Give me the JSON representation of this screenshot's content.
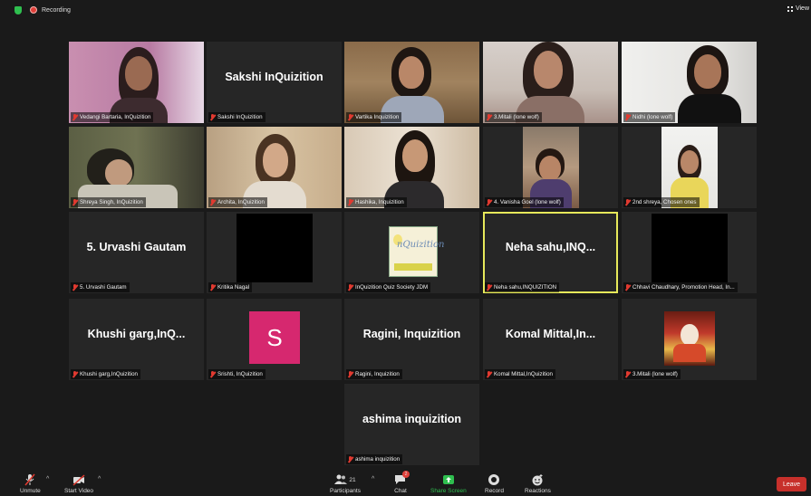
{
  "topbar": {
    "recording": "Recording",
    "view": "View"
  },
  "tiles": [
    {
      "label": "Vedangi Bartaria, InQuizition"
    },
    {
      "label": "Sakshi InQuizition",
      "bigname": "Sakshi InQuizition"
    },
    {
      "label": "Vartika Inquizition"
    },
    {
      "label": "3.Mitali (lone wolf)"
    },
    {
      "label": "Nidhi (lone wolf)"
    },
    {
      "label": "Shreya Singh, InQuizition"
    },
    {
      "label": "Archita, InQuizition"
    },
    {
      "label": "Hashika, Inquizition"
    },
    {
      "label": "4. Vanisha Goel (lone wolf)"
    },
    {
      "label": "2nd shreya, Chosen ones"
    },
    {
      "label": "5. Urvashi Gautam",
      "bigname": "5. Urvashi Gautam"
    },
    {
      "label": "Kritika Nagal"
    },
    {
      "label": "InQuizition Quiz Society JDM",
      "logo_text": "nQuizition"
    },
    {
      "label": "Neha sahu,INQUIZITION",
      "bigname": "Neha sahu,INQ..."
    },
    {
      "label": "Chhavi Chaudhary, Promotion Head, In..."
    },
    {
      "label": "Khushi garg,InQuizition",
      "bigname": "Khushi garg,InQ..."
    },
    {
      "label": "Srishti, InQuizition",
      "avatar_letter": "S"
    },
    {
      "label": "Ragini, Inquizition",
      "bigname": "Ragini, Inquizition"
    },
    {
      "label": "Komal Mittal,InQuizition",
      "bigname": "Komal Mittal,In..."
    },
    {
      "label": "3.Mitali (lone wolf)"
    },
    {
      "label": "ashima inquizition",
      "bigname": "ashima inquizition"
    }
  ],
  "toolbar": {
    "unmute": "Unmute",
    "start_video": "Start Video",
    "participants": "Participants",
    "participants_count": "21",
    "chat": "Chat",
    "chat_badge": "2",
    "share_screen": "Share Screen",
    "record": "Record",
    "reactions": "Reactions",
    "leave": "Leave"
  },
  "colors": {
    "background": "#1a1a1a",
    "tile": "#262626",
    "active_speaker": "#e6e85a",
    "leave": "#c7302b",
    "share_screen": "#2fbf4f",
    "mic_off": "#e23a30"
  },
  "icons": [
    "shield-icon",
    "recording-icon",
    "grid-view-icon",
    "mic-off-icon",
    "video-off-icon",
    "participants-icon",
    "chat-icon",
    "share-screen-icon",
    "record-icon",
    "reactions-icon"
  ]
}
